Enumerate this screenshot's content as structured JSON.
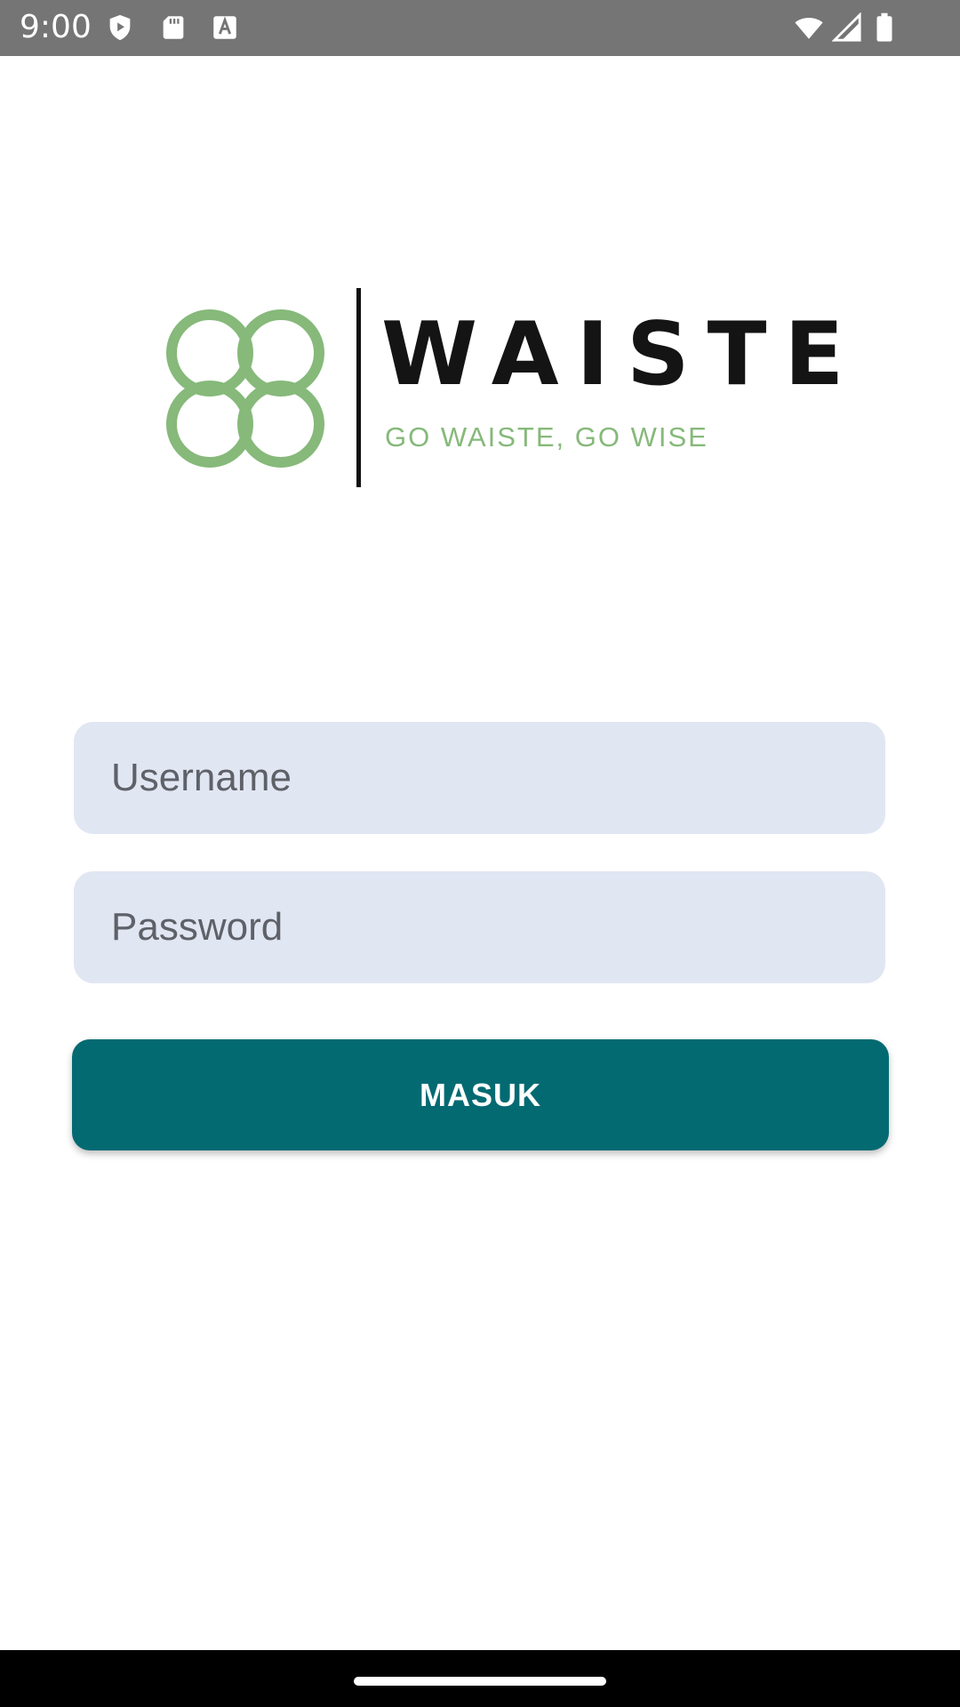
{
  "status_bar": {
    "time": "9:00",
    "icons": [
      "play-protect-icon",
      "sd-card-icon",
      "text-a-icon",
      "wifi-icon",
      "signal-icon",
      "battery-icon"
    ],
    "background": "#757575"
  },
  "logo": {
    "wordmark": "WAISTE",
    "tagline": "GO WAISTE, GO WISE",
    "mark_color": "#86b97a"
  },
  "form": {
    "username_placeholder": "Username",
    "password_placeholder": "Password",
    "field_background": "#e1e6f3",
    "submit_label": "MASUK",
    "submit_color": "#036a72"
  }
}
